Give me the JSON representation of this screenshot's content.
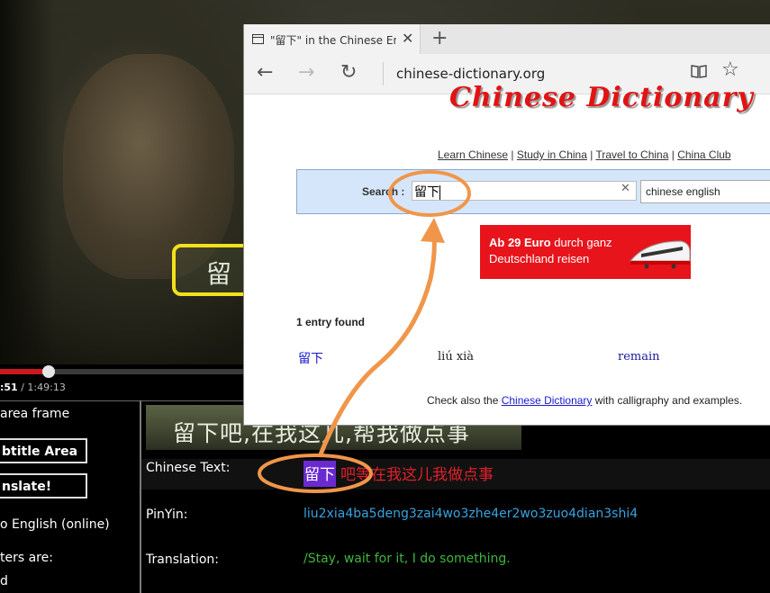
{
  "video": {
    "subtitle_partial": "留",
    "time_current": ":51",
    "time_separator": " / ",
    "time_total": "1:49:13",
    "playback_progress": 0.011
  },
  "left_panel": {
    "area_frame_label": "area frame",
    "subtitle_area_button": "btitle Area",
    "translate_button": "nslate!",
    "to_english_label": "o English (online)",
    "characters_label": "ters are:",
    "last_line": "d"
  },
  "subtitle_strip": {
    "text": "留下吧,在我这儿,帮我做点事"
  },
  "fields": {
    "chinese_label": "Chinese Text:",
    "chinese_highlight": "留下",
    "chinese_rest": "吧等在我这儿我做点事",
    "pinyin_label": "PinYin:",
    "pinyin_value": "liu2xia4ba5deng3zai4wo3zhe4er2wo3zuo4dian3shi4",
    "translation_label": "Translation:",
    "translation_value": "/Stay, wait for it, I do something."
  },
  "browser": {
    "tab_title": "\"留下\" in the Chinese Engl",
    "address": "chinese-dictionary.org",
    "logo_text": "Chinese Dictionary",
    "nav_links": [
      "Learn Chinese",
      "Study in China",
      "Travel to China",
      "China Club"
    ],
    "nav_sep": " | ",
    "search_label": "Search :",
    "search_value": "留下",
    "language_value": "chinese english",
    "ad": {
      "bold": "Ab 29 Euro",
      "line1_rest": " durch ganz",
      "line2": "Deutschland reisen"
    },
    "entries_found": "1 entry found",
    "result": {
      "chinese": "留下",
      "pinyin": "liú xià",
      "meaning": "remain"
    },
    "footer": {
      "prefix": "Check also the ",
      "link": "Chinese Dictionary",
      "suffix": " with calligraphy and examples."
    }
  },
  "colors": {
    "annotation_orange": "#f0964a",
    "highlight_yellow": "#f2e11a",
    "pinyin_blue": "#38a3e0",
    "translation_green": "#3fb63f",
    "chinese_red": "#e0202a",
    "selection_purple": "#6a2ad0",
    "logo_red": "#e21313"
  },
  "icons": [
    "tab-page-icon",
    "close-icon",
    "new-tab-icon",
    "back-arrow-icon",
    "forward-arrow-icon",
    "refresh-icon",
    "reading-view-icon",
    "favorite-star-icon",
    "clear-search-icon",
    "train-image"
  ]
}
